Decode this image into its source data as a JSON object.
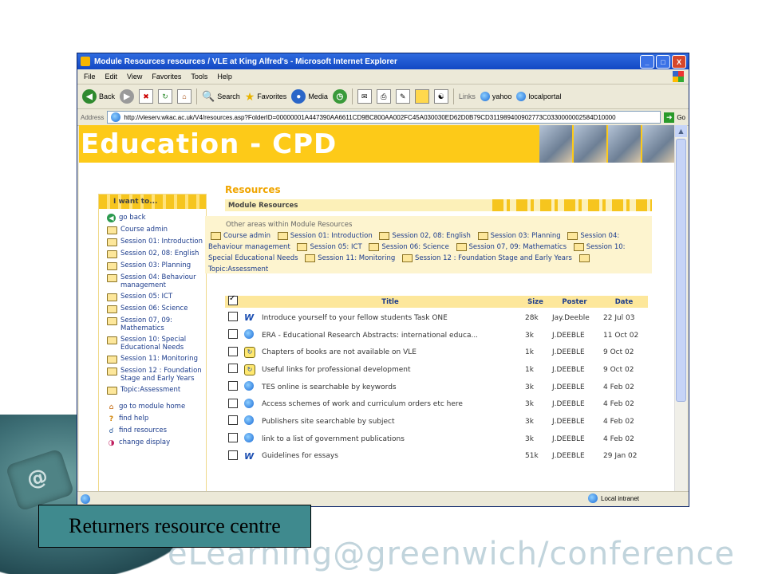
{
  "window": {
    "title": "Module Resources resources / VLE at King Alfred's - Microsoft Internet Explorer",
    "controls": [
      "_",
      "□",
      "X"
    ]
  },
  "menu": [
    "File",
    "Edit",
    "View",
    "Favorites",
    "Tools",
    "Help"
  ],
  "toolbar": {
    "back": "Back",
    "search": "Search",
    "favorites": "Favorites",
    "media": "Media",
    "links_label": "Links",
    "link1": "yahoo",
    "link2": "localportal"
  },
  "address": {
    "label": "Address",
    "url": "http://vleserv.wkac.ac.uk/V4/resources.asp?FolderID=00000001A447390AA6611CD9BC800AA002FC45A030030ED62D0B79CD311989400902773C0330000002584D10000",
    "go": "Go"
  },
  "banner": {
    "title": "Education - CPD"
  },
  "sidebar": {
    "header": "I want to...",
    "items": [
      {
        "label": "go back",
        "icon": "go-back-icon"
      },
      {
        "label": "Course admin",
        "icon": "folder-icon"
      },
      {
        "label": "Session 01: Introduction",
        "icon": "folder-icon"
      },
      {
        "label": "Session 02, 08: English",
        "icon": "folder-icon"
      },
      {
        "label": "Session 03: Planning",
        "icon": "folder-icon"
      },
      {
        "label": "Session 04: Behaviour management",
        "icon": "folder-icon"
      },
      {
        "label": "Session 05: ICT",
        "icon": "folder-icon"
      },
      {
        "label": "Session 06: Science",
        "icon": "folder-icon"
      },
      {
        "label": "Session 07, 09: Mathematics",
        "icon": "folder-icon"
      },
      {
        "label": "Session 10: Special Educational Needs",
        "icon": "folder-icon"
      },
      {
        "label": "Session 11: Monitoring",
        "icon": "folder-icon"
      },
      {
        "label": "Session 12 : Foundation Stage and Early Years",
        "icon": "folder-icon"
      },
      {
        "label": "Topic:Assessment",
        "icon": "folder-icon"
      }
    ],
    "actions": [
      {
        "label": "go to module home",
        "icon": "home-icon"
      },
      {
        "label": "find help",
        "icon": "help-icon"
      },
      {
        "label": "find resources",
        "icon": "find-icon"
      },
      {
        "label": "change display",
        "icon": "display-icon"
      }
    ]
  },
  "main": {
    "heading": "Resources",
    "module_bar": "Module Resources",
    "other_label": "Other areas within Module Resources",
    "other_links": [
      "Course admin",
      "Session 01: Introduction",
      "Session 02, 08: English",
      "Session 03: Planning",
      "Session 04: Behaviour management",
      "Session 05: ICT",
      "Session 06: Science",
      "Session 07, 09: Mathematics",
      "Session 10: Special Educational Needs",
      "Session 11: Monitoring",
      "Session 12 : Foundation Stage and Early Years",
      "Topic:Assessment"
    ],
    "columns": [
      "Title",
      "Size",
      "Poster",
      "Date"
    ],
    "rows": [
      {
        "type": "word",
        "title": "Introduce yourself to your fellow students Task ONE",
        "size": "28k",
        "poster": "Jay.Deeble",
        "date": "22 Jul 03"
      },
      {
        "type": "ie",
        "title": "ERA - Educational Research Abstracts: international educa...",
        "size": "3k",
        "poster": "J.DEEBLE",
        "date": "11 Oct 02"
      },
      {
        "type": "link",
        "title": "Chapters of books are not available on VLE",
        "size": "1k",
        "poster": "J.DEEBLE",
        "date": "9 Oct 02"
      },
      {
        "type": "link",
        "title": "Useful links for professional development",
        "size": "1k",
        "poster": "J.DEEBLE",
        "date": "9 Oct 02"
      },
      {
        "type": "ie",
        "title": "TES online is searchable by keywords",
        "size": "3k",
        "poster": "J.DEEBLE",
        "date": "4 Feb 02"
      },
      {
        "type": "ie",
        "title": "Access schemes of work and curriculum orders etc here",
        "size": "3k",
        "poster": "J.DEEBLE",
        "date": "4 Feb 02"
      },
      {
        "type": "ie",
        "title": "Publishers site searchable by subject",
        "size": "3k",
        "poster": "J.DEEBLE",
        "date": "4 Feb 02"
      },
      {
        "type": "ie",
        "title": "link to a list of government publications",
        "size": "3k",
        "poster": "J.DEEBLE",
        "date": "4 Feb 02"
      },
      {
        "type": "word",
        "title": "Guidelines for essays",
        "size": "51k",
        "poster": "J.DEEBLE",
        "date": "29 Jan 02"
      }
    ]
  },
  "status": {
    "zone": "Local intranet"
  },
  "slide": {
    "caption": "Returners resource centre",
    "footer_brand": "eLearning@greenwich/conference"
  },
  "colors": {
    "banner": "#fdca18",
    "accent": "#f0a500",
    "link": "#1c3c8c",
    "caption_bg": "#3f8a8e"
  }
}
